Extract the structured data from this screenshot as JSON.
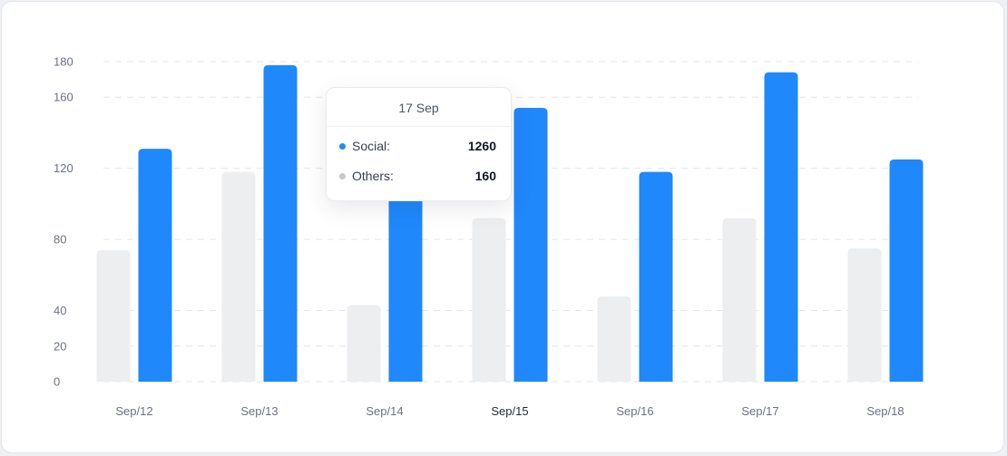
{
  "chart_data": {
    "type": "bar",
    "categories": [
      "Sep/12",
      "Sep/13",
      "Sep/14",
      "Sep/15",
      "Sep/16",
      "Sep/17",
      "Sep/18"
    ],
    "series": [
      {
        "values": [
          74,
          118,
          43,
          92,
          48,
          92,
          75
        ],
        "color": "#edeef0"
      },
      {
        "values": [
          131,
          178,
          111,
          154,
          118,
          174,
          125
        ],
        "color": "#1f88fb"
      }
    ],
    "ylim": [
      0,
      180
    ],
    "yticks": [
      0,
      20,
      40,
      80,
      120,
      160,
      180
    ],
    "active_category": "Sep/15",
    "grid": true,
    "legend": "none"
  },
  "tooltip": {
    "title": "17 Sep",
    "rows": [
      {
        "label": "Social:",
        "value": "1260",
        "dot_color": "#1f88fb"
      },
      {
        "label": "Others:",
        "value": "160",
        "dot_color": "#c4c8cf"
      }
    ]
  }
}
